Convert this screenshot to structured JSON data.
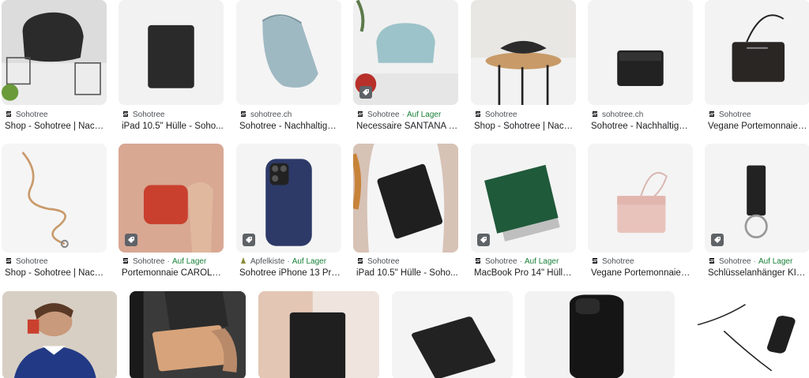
{
  "colors": {
    "stock": "#188038",
    "source": "#4d5156",
    "title": "#202124"
  },
  "row1": [
    {
      "source": "Sohotree",
      "stock": "",
      "title": "Shop - Sohotree | Nach...",
      "icon": "sohotree-favicon"
    },
    {
      "source": "Sohotree",
      "stock": "",
      "title": "iPad 10.5\" Hülle - Soho...",
      "icon": "sohotree-favicon"
    },
    {
      "source": "sohotree.ch",
      "stock": "",
      "title": "Sohotree - Nachhaltige ...",
      "icon": "sohotree-favicon"
    },
    {
      "source": "Sohotree",
      "stock": "Auf Lager",
      "title": "Necessaire SANTANA - ...",
      "icon": "sohotree-favicon"
    },
    {
      "source": "Sohotree",
      "stock": "",
      "title": "Shop - Sohotree | Nach...",
      "icon": "sohotree-favicon"
    },
    {
      "source": "sohotree.ch",
      "stock": "",
      "title": "Sohotree - Nachhaltige ...",
      "icon": "sohotree-favicon"
    },
    {
      "source": "Sohotree",
      "stock": "",
      "title": "Vegane Portemonnaies...",
      "icon": "sohotree-favicon"
    }
  ],
  "row2": [
    {
      "source": "Sohotree",
      "stock": "",
      "title": "Shop - Sohotree | Nach...",
      "icon": "sohotree-favicon"
    },
    {
      "source": "Sohotree",
      "stock": "Auf Lager",
      "title": "Portemonnaie CAROLA ...",
      "icon": "sohotree-favicon"
    },
    {
      "source": "Apfelkiste",
      "stock": "Auf Lager",
      "title": "Sohotree iPhone 13 Pro...",
      "icon": "apfelkiste-favicon"
    },
    {
      "source": "Sohotree",
      "stock": "",
      "title": "iPad 10.5\" Hülle - Soho...",
      "icon": "sohotree-favicon"
    },
    {
      "source": "Sohotree",
      "stock": "Auf Lager",
      "title": "MacBook Pro 14\" Hülle -...",
      "icon": "sohotree-favicon"
    },
    {
      "source": "Sohotree",
      "stock": "",
      "title": "Vegane Portemonnaies ...",
      "icon": "sohotree-favicon"
    },
    {
      "source": "Sohotree",
      "stock": "Auf Lager",
      "title": "Schlüsselanhänger KIK...",
      "icon": "sohotree-favicon"
    }
  ],
  "separator": "·"
}
